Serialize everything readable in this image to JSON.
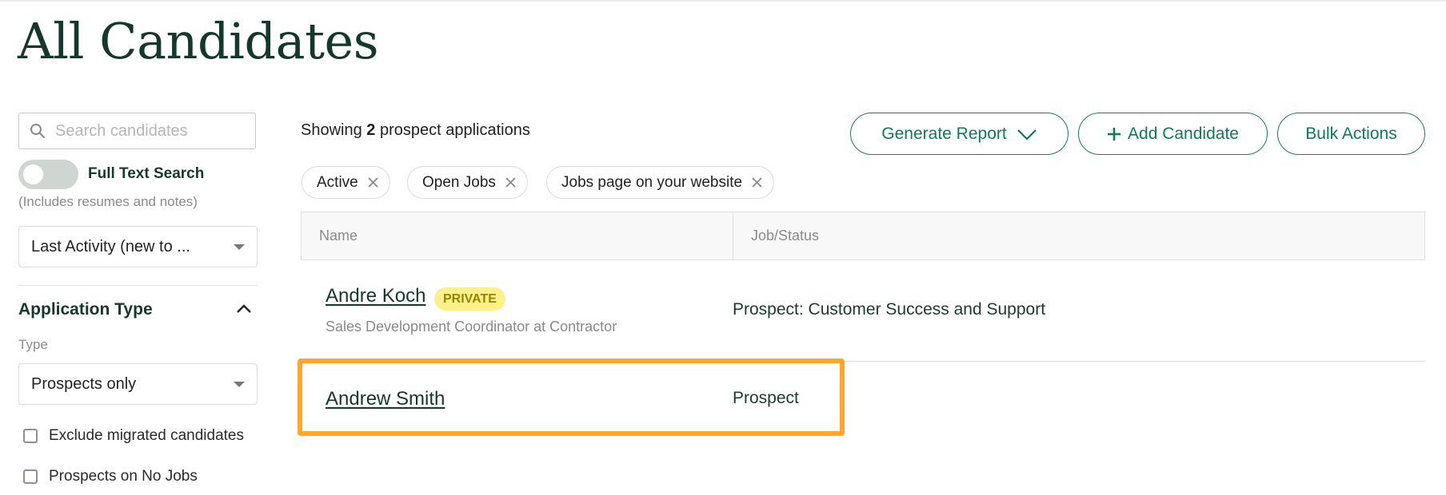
{
  "page": {
    "title": "All Candidates"
  },
  "sidebar": {
    "search": {
      "placeholder": "Search candidates",
      "value": "",
      "icon": "search-icon"
    },
    "full_text_search": {
      "label": "Full Text Search",
      "hint": "(Includes resumes and notes)",
      "enabled": false
    },
    "sort": {
      "selected": "Last Activity (new to ..."
    },
    "application_type": {
      "title": "Application Type",
      "expanded": true,
      "type_label": "Type",
      "type_selected": "Prospects only",
      "checkboxes": [
        {
          "label": "Exclude migrated candidates",
          "checked": false
        },
        {
          "label": "Prospects on No Jobs",
          "checked": false
        }
      ]
    }
  },
  "main": {
    "showing": {
      "prefix": "Showing",
      "count": "2",
      "suffix": "prospect applications"
    },
    "buttons": {
      "generate_report": "Generate Report",
      "add_candidate": "Add Candidate",
      "bulk_actions": "Bulk Actions"
    },
    "filters": [
      {
        "label": "Active"
      },
      {
        "label": "Open Jobs"
      },
      {
        "label": "Jobs page on your website"
      }
    ],
    "table": {
      "columns": [
        "Name",
        "Job/Status"
      ],
      "rows": [
        {
          "name": "Andre Koch",
          "badge": "PRIVATE",
          "subtitle": "Sales Development Coordinator at Contractor",
          "job_status": "Prospect: Customer Success and Support"
        },
        {
          "name": "Andrew Smith",
          "badge": "",
          "subtitle": "",
          "job_status": "Prospect",
          "highlighted": true
        }
      ]
    }
  },
  "colors": {
    "brand_dark": "#15372c",
    "accent_green": "#0f7a55",
    "highlight": "#fda72f",
    "badge_bg": "#fbf08a"
  }
}
